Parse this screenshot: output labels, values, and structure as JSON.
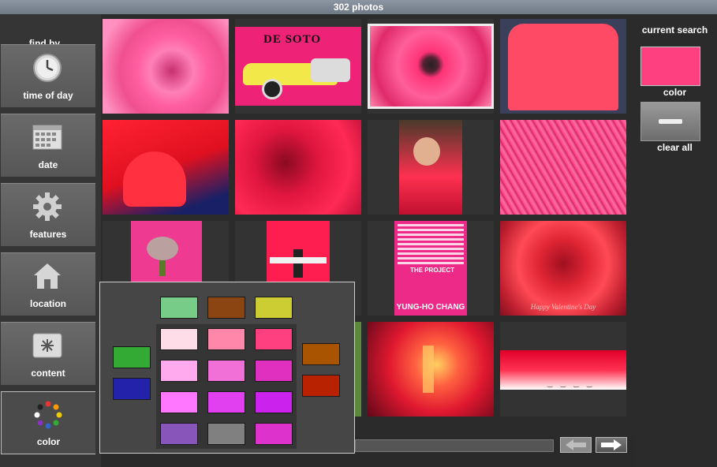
{
  "header": {
    "title": "302 photos"
  },
  "sidebar": {
    "title": "find by...",
    "items": [
      {
        "label": "time of day",
        "icon": "clock-icon"
      },
      {
        "label": "date",
        "icon": "calendar-icon"
      },
      {
        "label": "features",
        "icon": "gear-icon"
      },
      {
        "label": "location",
        "icon": "house-icon"
      },
      {
        "label": "content",
        "icon": "sparkle-icon"
      },
      {
        "label": "color",
        "icon": "color-wheel-icon"
      }
    ],
    "active": "color"
  },
  "search": {
    "title": "current search",
    "color_label": "color",
    "selected_color": "#ff4080",
    "clear_label": "clear all"
  },
  "photos": [
    {
      "subject": "pink swirl",
      "text": ""
    },
    {
      "subject": "de soto car ad",
      "text": "DE SOTO"
    },
    {
      "subject": "pink gerbera daisy",
      "text": ""
    },
    {
      "subject": "pink t-shirt",
      "text": ""
    },
    {
      "subject": "red heart pillow",
      "text": ""
    },
    {
      "subject": "red flower close-up",
      "text": ""
    },
    {
      "subject": "child in red hoodie",
      "text": ""
    },
    {
      "subject": "pink feathery plant",
      "text": ""
    },
    {
      "subject": "orchid on pink",
      "text": ""
    },
    {
      "subject": "dancer on pink",
      "text": ""
    },
    {
      "subject": "the project poster",
      "text": "THE PROJECT",
      "subtext": "YUNG-HO CHANG"
    },
    {
      "subject": "red rose",
      "text": "Happy Valentine's Day"
    },
    {
      "subject": "hidden",
      "text": ""
    },
    {
      "subject": "hidden",
      "text": ""
    },
    {
      "subject": "concert guitarist",
      "text": ""
    },
    {
      "subject": "red sky with birds",
      "text": ""
    }
  ],
  "color_picker": {
    "left_column": [
      "#33aa33",
      "#2222aa"
    ],
    "right_column": [
      "#a85400",
      "#b82200"
    ],
    "top_row": [
      "#77cc88",
      "#8b4513",
      "#cccc33"
    ],
    "grid": [
      [
        "#ffdde8",
        "#ff88aa",
        "#ff4080"
      ],
      [
        "#ffaaee",
        "#f070d8",
        "#e030c0"
      ],
      [
        "#ff77ff",
        "#e040f0",
        "#cc22ee"
      ]
    ],
    "bottom_row": [
      "#8855bb",
      "#808080",
      "#dd33cc"
    ]
  },
  "nav": {
    "back": "back-arrow",
    "forward": "forward-arrow"
  }
}
